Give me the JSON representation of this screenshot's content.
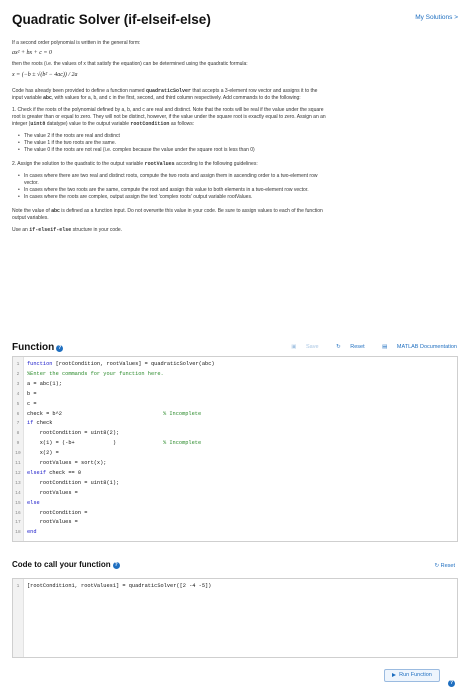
{
  "header": {
    "title": "Quadratic Solver (if-elseif-else)",
    "my_solutions": "My Solutions >"
  },
  "description": {
    "intro": "If a second order polynomial is written in the general form:",
    "general_form": "ax² + bx + c = 0",
    "then_roots": "then the roots (i.e. the values of x that satisfy the equation) can be determined using the quadratic formula:",
    "quadratic_formula": "x = (−b ± √(b² − 4ac)) / 2a",
    "code_provided_1": "Code has already been provided to define a function named ",
    "function_name": "quadraticSolver",
    "code_provided_2": " that accepts a 3-element row vector and assigns it to the",
    "code_provided_3a": "input variable ",
    "abc_var": "abc",
    "code_provided_3b": ", with values for a, b, and c in the first, second, and third column respectively. Add commands to do the following:",
    "step1_line1": "1. Check if the roots of the polynomial defined by a, b, and c are real and distinct. Note that the roots will be real if the value under the square",
    "step1_line2": "root is greater than or equal to zero. They will not be distinct, however, if the value under the square root is exactly equal to zero. Assign an an",
    "step1_line3a": "integer (",
    "uint8_type": "uint8",
    "step1_line3b": " datatype) value to the output variable ",
    "root_condition": "rootCondition",
    "step1_line3c": " as follows:",
    "bullets1": [
      "The value 2 if the roots are real and distinct",
      "The value 1 if the two roots are the same.",
      "The value 0 if the roots are not real (i.e. complex because the value under the square root is less than 0)"
    ],
    "step2_a": "2. Assign the solution to the quadratic to the output variable ",
    "root_values": "rootValues",
    "step2_b": " according to the following guidelines:",
    "bullets2": [
      "In cases where there are two real and distinct roots, compute the two roots and assign them in ascending order to a two-element row",
      "vector.",
      "In cases where the two roots are the same, compute the root and assign this value to both elements in a two-element row vector.",
      "In cases where the roots are complex, output assign the text 'complex roots' output variable rootValues."
    ],
    "note_a": "Note the value of ",
    "note_abc": "abc",
    "note_b": " is defined as a function input. Do not overwrite this value in your code. Be sure to assign values to each of the function",
    "note_c": "output variables.",
    "use_a": "Use an ",
    "use_kw": "if-elseif-else",
    "use_b": " structure in your code."
  },
  "function_section": {
    "heading": "Function",
    "save": "Save",
    "reset": "Reset",
    "docs": "MATLAB Documentation",
    "lines": [
      {
        "n": "1",
        "kw": "function",
        "text": " [rootCondition, rootValues] = quadraticSolver(abc)",
        "cmt": ""
      },
      {
        "n": "2",
        "kw": "",
        "text": "",
        "cmt": "%Enter the commands for your function here."
      },
      {
        "n": "3",
        "kw": "",
        "text": "a = abc(1);",
        "cmt": ""
      },
      {
        "n": "4",
        "kw": "",
        "text": "b =",
        "cmt": ""
      },
      {
        "n": "5",
        "kw": "",
        "text": "c =",
        "cmt": ""
      },
      {
        "n": "6",
        "kw": "",
        "text": "check = b^2",
        "cmt": "% Incomplete"
      },
      {
        "n": "7",
        "kw": "if",
        "text": " check",
        "cmt": ""
      },
      {
        "n": "8",
        "kw": "",
        "text": "    rootCondition = uint8(2);",
        "cmt": ""
      },
      {
        "n": "9",
        "kw": "",
        "text": "    x(1) = (-b+            )",
        "cmt": "% Incomplete"
      },
      {
        "n": "10",
        "kw": "",
        "text": "    x(2) =",
        "cmt": ""
      },
      {
        "n": "11",
        "kw": "",
        "text": "    rootValues = sort(x);",
        "cmt": ""
      },
      {
        "n": "12",
        "kw": "elseif",
        "text": " check == 0",
        "cmt": ""
      },
      {
        "n": "13",
        "kw": "",
        "text": "    rootCondition = uint8(1);",
        "cmt": ""
      },
      {
        "n": "14",
        "kw": "",
        "text": "    rootValues =",
        "cmt": ""
      },
      {
        "n": "15",
        "kw": "else",
        "text": "",
        "cmt": ""
      },
      {
        "n": "16",
        "kw": "",
        "text": "    rootCondition =",
        "cmt": ""
      },
      {
        "n": "17",
        "kw": "",
        "text": "    rootValues =",
        "cmt": ""
      },
      {
        "n": "18",
        "kw": "end",
        "text": "",
        "cmt": ""
      }
    ]
  },
  "call_section": {
    "heading": "Code to call your function",
    "reset": "Reset",
    "line_num": "1",
    "line": "[rootCondition1, rootValues1] = quadraticSolver([2 -4 -5])",
    "run_button": "Run Function"
  },
  "colors": {
    "link": "#1f6fc0",
    "keyword": "#1414c8",
    "comment": "#2a8a2a"
  }
}
